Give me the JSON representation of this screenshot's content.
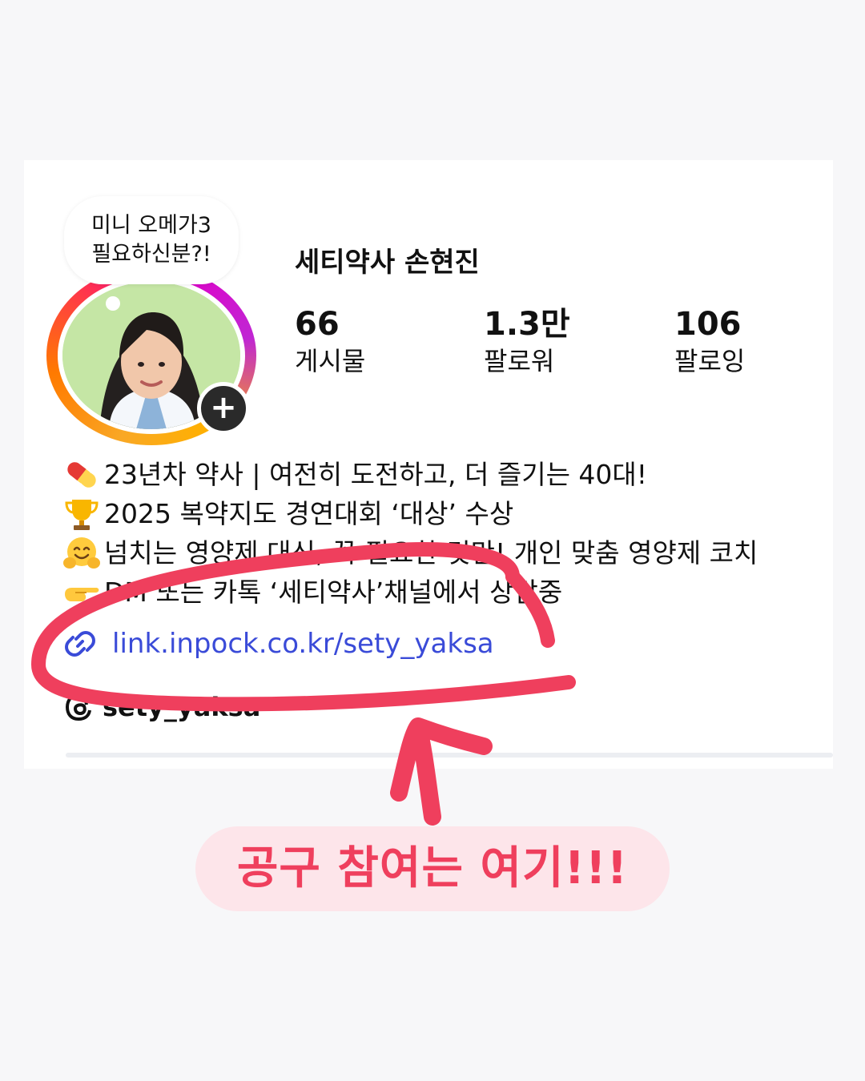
{
  "profile": {
    "name": "세티약사 손현진",
    "note": {
      "line1": "미니 오메가3",
      "line2": "필요하신분?!"
    }
  },
  "stats": [
    {
      "value": "66",
      "label": "게시물"
    },
    {
      "value": "1.3만",
      "label": "팔로워"
    },
    {
      "value": "106",
      "label": "팔로잉"
    }
  ],
  "bio": [
    {
      "icon": "pill-icon",
      "text": "23년차 약사 | 여전히 도전하고, 더 즐기는 40대!"
    },
    {
      "icon": "trophy-icon",
      "text": "2025 복약지도 경연대회 ‘대상’ 수상"
    },
    {
      "icon": "hugging-face-icon",
      "text": "넘치는 영양제 대신, 꼭 필요한 것만! 개인 맞춤 영양제 코치"
    },
    {
      "icon": "pointing-hand-icon",
      "text": "DM 또는 카톡 ‘세티약사’채널에서 상담중"
    }
  ],
  "link": "link.inpock.co.kr/sety_yaksa",
  "threads": "sety_yaksa",
  "cta": "공구 참여는 여기!!!",
  "colors": {
    "link": "#3a4bd8",
    "highlight": "#ef3f5d",
    "pill_background": "#fde5ea"
  }
}
